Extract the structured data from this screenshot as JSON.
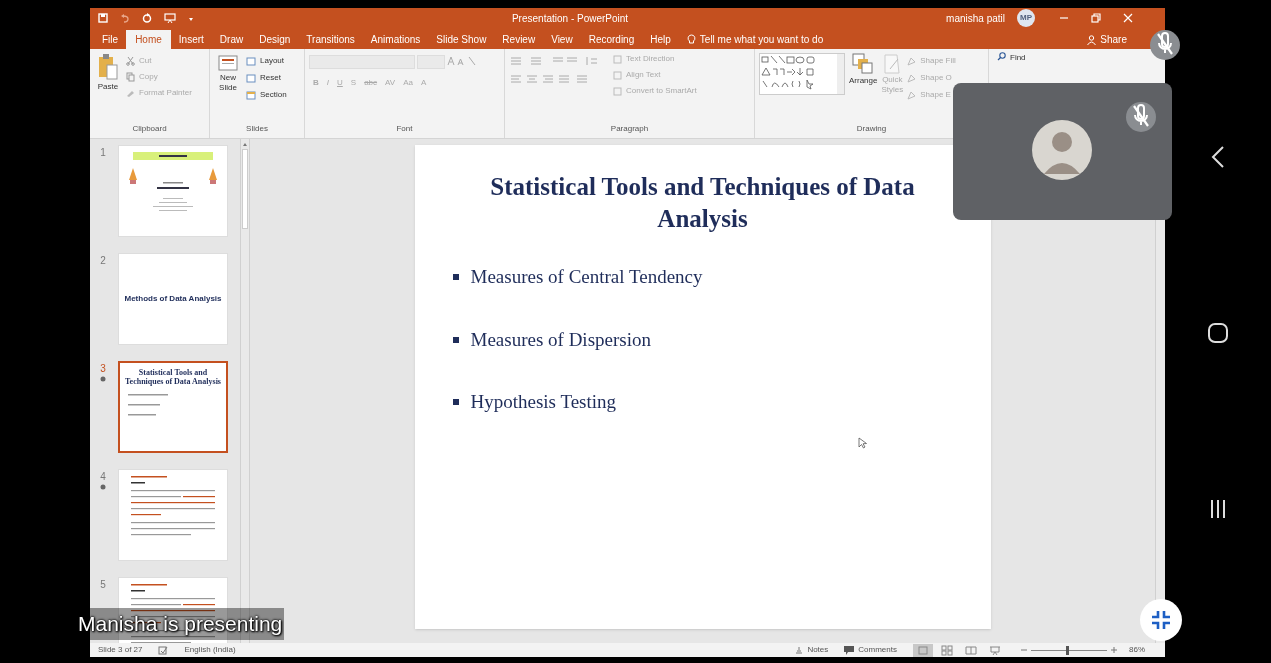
{
  "title_bar": {
    "title": "Presentation  -  PowerPoint",
    "user": "manisha patil",
    "initials": "MP"
  },
  "tabs": [
    {
      "label": "File",
      "selected": false
    },
    {
      "label": "Home",
      "selected": true
    },
    {
      "label": "Insert",
      "selected": false
    },
    {
      "label": "Draw",
      "selected": false
    },
    {
      "label": "Design",
      "selected": false
    },
    {
      "label": "Transitions",
      "selected": false
    },
    {
      "label": "Animations",
      "selected": false
    },
    {
      "label": "Slide Show",
      "selected": false
    },
    {
      "label": "Review",
      "selected": false
    },
    {
      "label": "View",
      "selected": false
    },
    {
      "label": "Recording",
      "selected": false
    },
    {
      "label": "Help",
      "selected": false
    }
  ],
  "tell_me": "Tell me what you want to do",
  "share": "Share",
  "ribbon": {
    "clipboard": {
      "label": "Clipboard",
      "paste": "Paste",
      "items": [
        {
          "label": "Cut",
          "disabled": true
        },
        {
          "label": "Copy",
          "disabled": true
        },
        {
          "label": "Format Painter",
          "disabled": true
        }
      ]
    },
    "slides": {
      "label": "Slides",
      "new_slide": [
        "New",
        "Slide"
      ],
      "items": [
        "Layout",
        "Reset",
        "Section"
      ]
    },
    "font": {
      "label": "Font",
      "buttons": [
        "B",
        "I",
        "U",
        "S",
        "abc",
        "AV",
        "Aa",
        "A"
      ]
    },
    "paragraph": {
      "label": "Paragraph",
      "items": [
        "Text Direction",
        "Align Text",
        "Convert to SmartArt"
      ]
    },
    "drawing": {
      "label": "Drawing",
      "arrange": "Arrange",
      "quick_styles": [
        "Quick",
        "Styles"
      ],
      "items": [
        "Shape Fill",
        "Shape O",
        "Shape E"
      ]
    },
    "find": "Find"
  },
  "thumbnails": [
    {
      "number": "1",
      "selected": false,
      "starred": false,
      "kind": "cover"
    },
    {
      "number": "2",
      "selected": false,
      "starred": false,
      "kind": "section",
      "title": "Methods of Data Analysis"
    },
    {
      "number": "3",
      "selected": true,
      "starred": true,
      "kind": "bullets",
      "title": "Statistical Tools and Techniques of Data Analysis"
    },
    {
      "number": "4",
      "selected": false,
      "starred": true,
      "kind": "text"
    },
    {
      "number": "5",
      "selected": false,
      "starred": false,
      "kind": "text"
    }
  ],
  "slide": {
    "title": "Statistical Tools and Techniques of Data Analysis",
    "bullets": [
      "Measures of Central Tendency",
      "Measures of Dispersion",
      "Hypothesis Testing"
    ]
  },
  "status_bar": {
    "slide": "Slide 3 of 27",
    "language": "English (India)",
    "notes": "Notes",
    "comments": "Comments",
    "views": [
      {
        "kind": "normal",
        "selected": true
      },
      {
        "kind": "sorter",
        "selected": false
      },
      {
        "kind": "reading",
        "selected": false
      },
      {
        "kind": "show",
        "selected": false
      }
    ],
    "zoom": {
      "level": 0.48
    },
    "zoom_reading": "86%"
  },
  "call": {
    "presenter": "Manisha is presenting",
    "top_mic_muted": true,
    "tile_mic_muted": true
  }
}
